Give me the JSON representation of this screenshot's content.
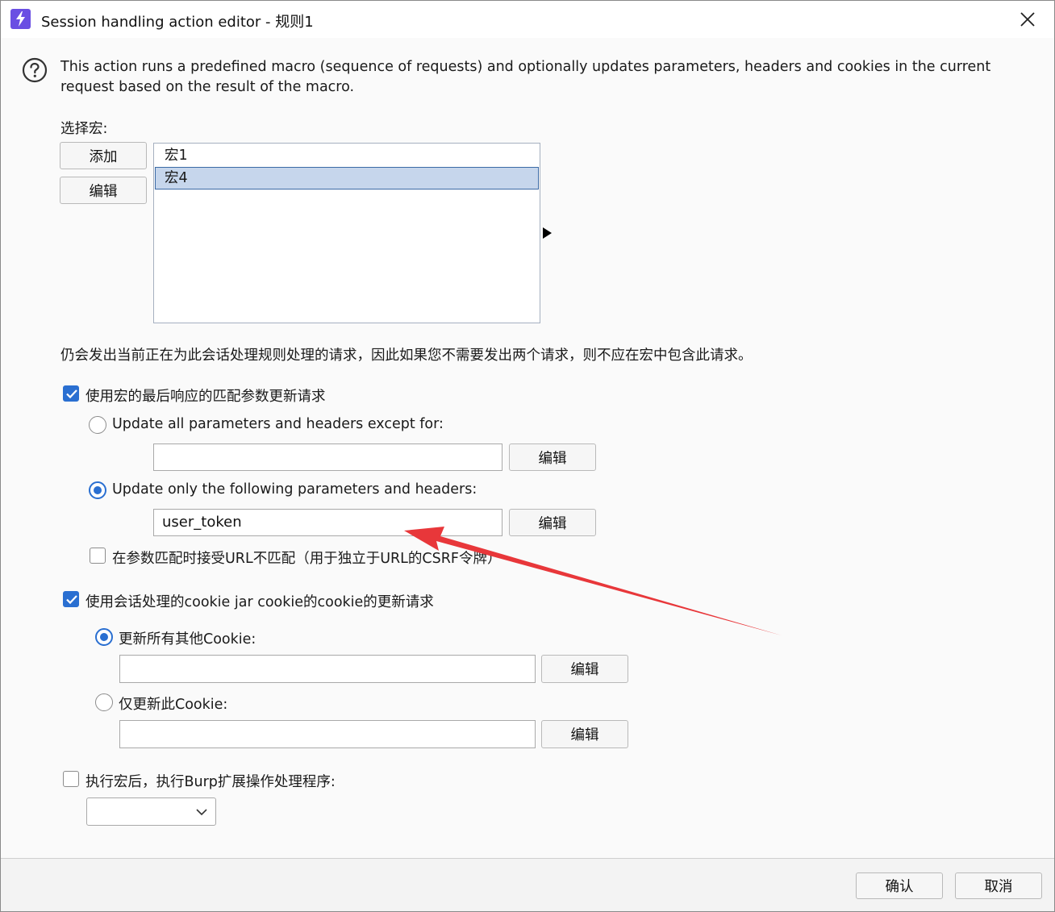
{
  "window": {
    "title": "Session handling action editor - 规则1"
  },
  "description": "This action runs a predefined macro (sequence of requests) and optionally updates parameters, headers and cookies in the current request based on the result of the macro.",
  "macro_select": {
    "label": "选择宏:",
    "add_button": "添加",
    "edit_button": "编辑",
    "items": [
      {
        "label": "宏1",
        "selected": false
      },
      {
        "label": "宏4",
        "selected": true
      }
    ]
  },
  "note": "仍会发出当前正在为此会话处理规则处理的请求，因此如果您不需要发出两个请求，则不应在宏中包含此请求。",
  "update_params": {
    "checkbox_label": "使用宏的最后响应的匹配参数更新请求",
    "checked": true,
    "option_all_label": "Update all parameters and headers except for:",
    "option_all_value": "",
    "option_all_edit": "编辑",
    "option_only_label": "Update only the following parameters and headers:",
    "option_only_value": "user_token",
    "option_only_edit": "编辑",
    "selected_option": "only",
    "accept_url_mismatch_label": "在参数匹配时接受URL不匹配（用于独立于URL的CSRF令牌）",
    "accept_url_mismatch_checked": false
  },
  "update_cookies": {
    "checkbox_label": "使用会话处理的cookie jar cookie的cookie的更新请求",
    "checked": true,
    "option_all_label": "更新所有其他Cookie:",
    "option_all_value": "",
    "option_all_edit": "编辑",
    "option_only_label": "仅更新此Cookie:",
    "option_only_value": "",
    "option_only_edit": "编辑",
    "selected_option": "all"
  },
  "extension": {
    "checkbox_label": "执行宏后，执行Burp扩展操作处理程序:",
    "checked": false,
    "selected_value": ""
  },
  "footer": {
    "ok_button": "确认",
    "cancel_button": "取消"
  },
  "colors": {
    "accent": "#2a6fd1",
    "selection": "#c6d6ec",
    "annotation_arrow": "#e8373a",
    "app_icon": "#6a4fe3"
  }
}
